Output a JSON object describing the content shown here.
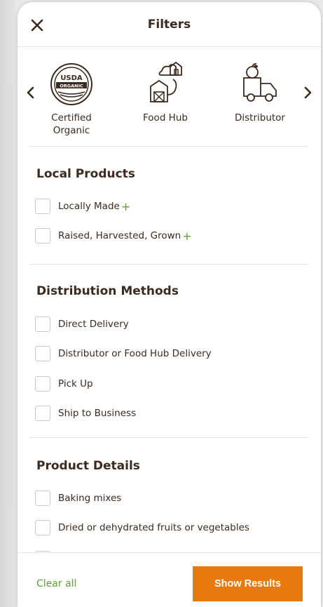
{
  "header": {
    "title": "Filters",
    "close_icon": "close-icon"
  },
  "certifications": [
    {
      "label": "Certified Organic",
      "icon": "usda-organic-icon"
    },
    {
      "label": "Food Hub",
      "icon": "food-hub-icon"
    },
    {
      "label": "Distributor",
      "icon": "distributor-icon"
    }
  ],
  "logo_text": {
    "line1": "USDA",
    "line2": "ORGANIC"
  },
  "sections": {
    "local": {
      "title": "Local Products",
      "options": [
        "Locally Made",
        "Raised, Harvested, Grown"
      ],
      "plus": "+"
    },
    "distribution": {
      "title": "Distribution Methods",
      "options": [
        "Direct Delivery",
        "Distributor or Food Hub Delivery",
        "Pick Up",
        "Ship to Business"
      ]
    },
    "details": {
      "title": "Product Details",
      "options": [
        "Baking mixes",
        "Dried or dehydrated fruits or vegetables"
      ]
    }
  },
  "footer": {
    "clear_label": "Clear all",
    "show_label": "Show Results"
  },
  "colors": {
    "accent_orange": "#e8790c",
    "accent_green": "#5aa332",
    "text_brown": "#3b2a1e"
  }
}
